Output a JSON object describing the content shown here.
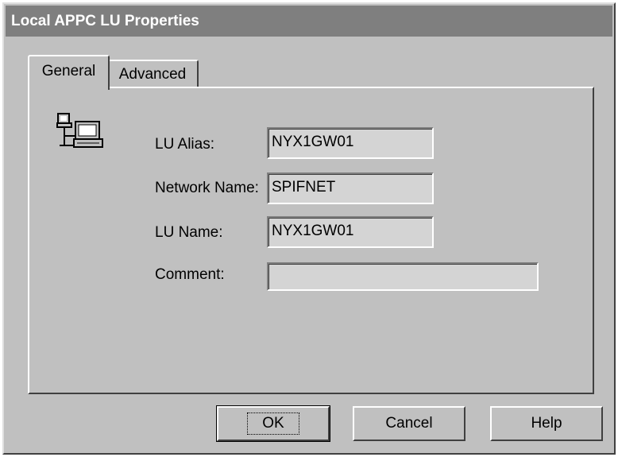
{
  "window": {
    "title": "Local APPC LU Properties"
  },
  "tabs": [
    {
      "label": "General",
      "selected": true
    },
    {
      "label": "Advanced",
      "selected": false
    }
  ],
  "icon": "network-computer-icon",
  "form": {
    "lu_alias": {
      "label": "LU Alias:",
      "value": "NYX1GW01"
    },
    "network_name": {
      "label": "Network Name:",
      "value": "SPIFNET"
    },
    "lu_name": {
      "label": "LU Name:",
      "value": "NYX1GW01"
    },
    "comment": {
      "label": "Comment:",
      "value": ""
    }
  },
  "buttons": {
    "ok": "OK",
    "cancel": "Cancel",
    "help": "Help"
  }
}
